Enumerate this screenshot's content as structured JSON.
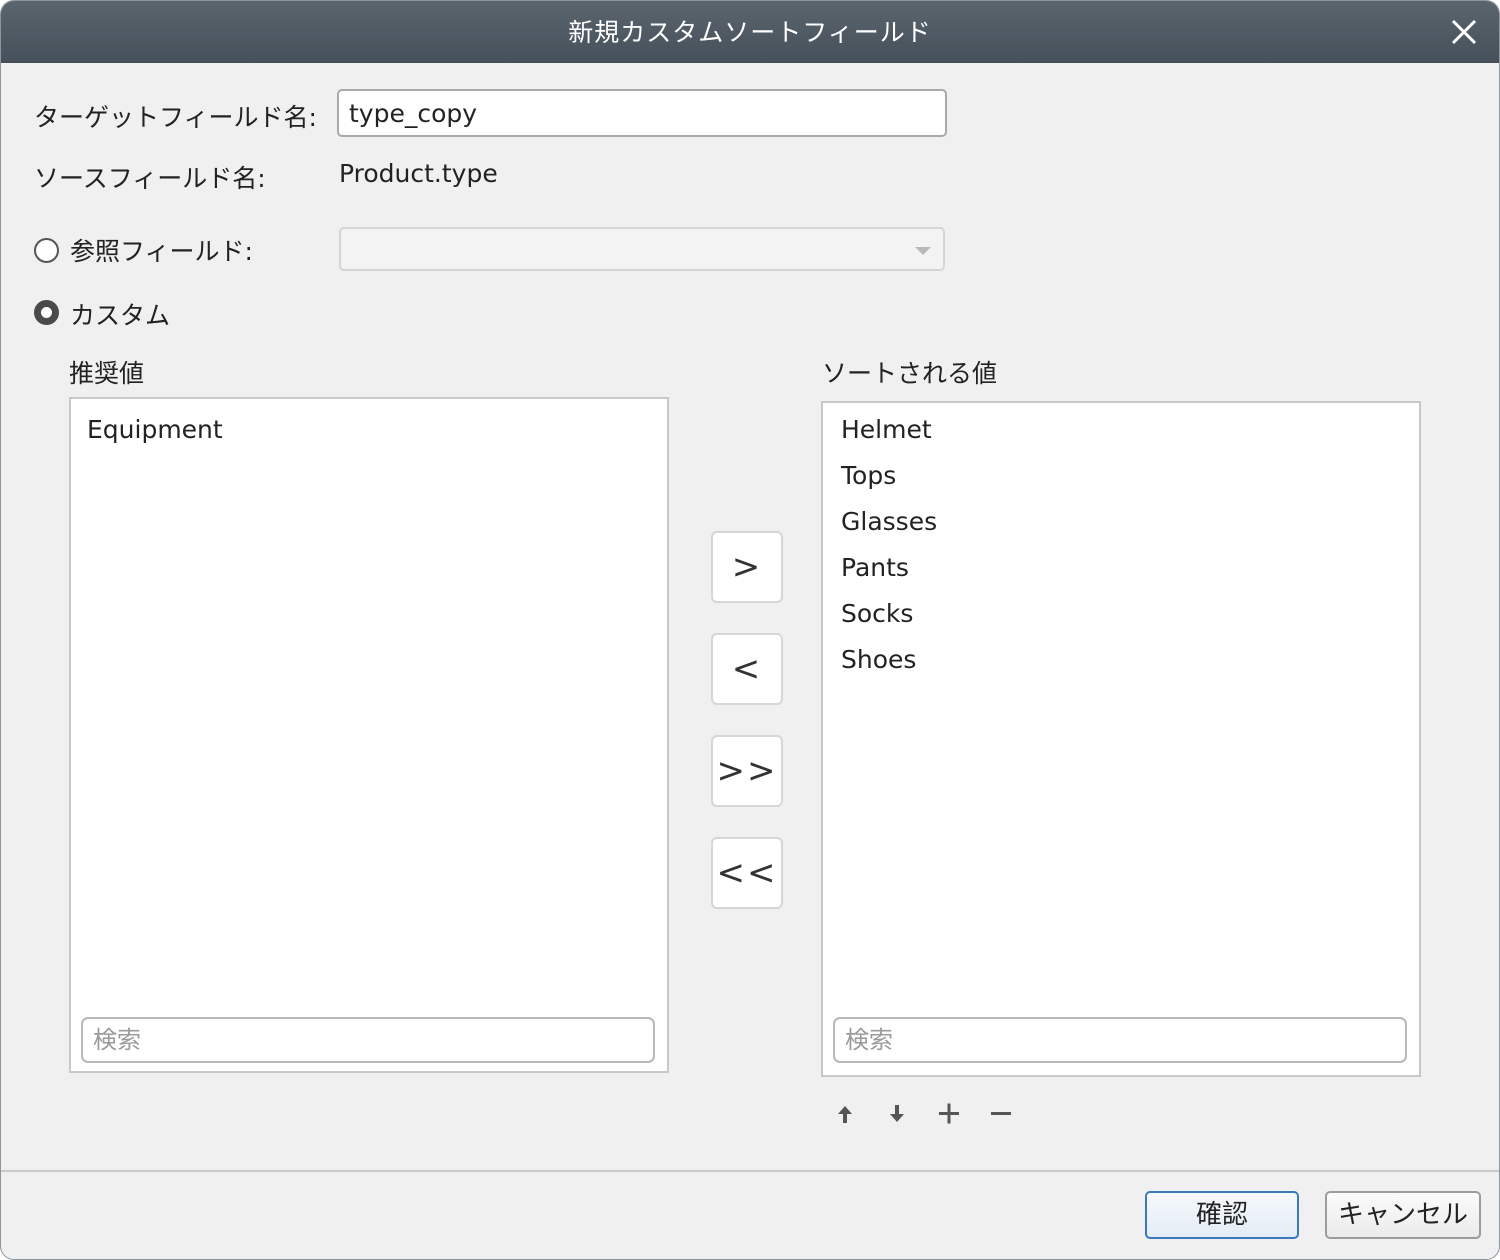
{
  "dialog": {
    "title": "新規カスタムソートフィールド"
  },
  "form": {
    "target_field_label": "ターゲットフィールド名:",
    "target_field_value": "type_copy",
    "source_field_label": "ソースフィールド名:",
    "source_field_value": "Product.type",
    "reference_field_label": "参照フィールド:",
    "reference_field_value": "",
    "reference_selected": false,
    "custom_label": "カスタム",
    "custom_selected": true
  },
  "suggested": {
    "heading": "推奨値",
    "items": [
      "Equipment"
    ],
    "search_placeholder": "検索"
  },
  "sorted": {
    "heading": "ソートされる値",
    "items": [
      "Helmet",
      "Tops",
      "Glasses",
      "Pants",
      "Socks",
      "Shoes"
    ],
    "search_placeholder": "検索"
  },
  "move_buttons": {
    "move_right": ">",
    "move_left": "<",
    "move_all_right": ">>",
    "move_all_left": "<<"
  },
  "toolbar_icons": [
    "arrow-up-icon",
    "arrow-down-icon",
    "plus-icon",
    "minus-icon"
  ],
  "footer": {
    "ok_label": "確認",
    "cancel_label": "キャンセル"
  },
  "colors": {
    "titlebar": "#4f5963",
    "ok_border": "#3d79b8"
  }
}
